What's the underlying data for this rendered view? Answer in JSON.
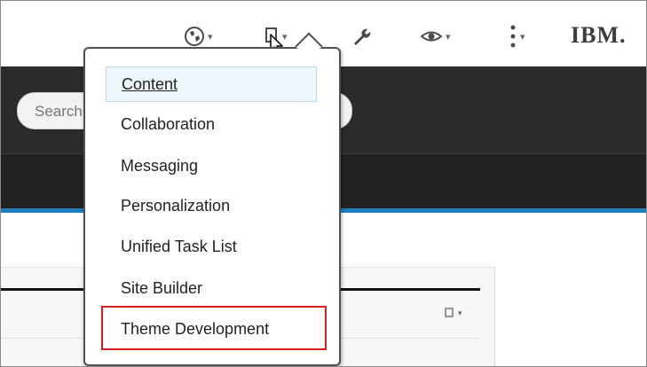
{
  "search": {
    "placeholder": "Search"
  },
  "brand": {
    "logo_text": "IBM."
  },
  "toolbar": {
    "icons": [
      "globe-icon",
      "page-icon",
      "wrench-icon",
      "eye-icon",
      "more-vertical-icon"
    ]
  },
  "menu": {
    "items": [
      {
        "label": "Content",
        "selected": true
      },
      {
        "label": "Collaboration"
      },
      {
        "label": "Messaging"
      },
      {
        "label": "Personalization"
      },
      {
        "label": "Unified Task List"
      },
      {
        "label": "Site Builder"
      },
      {
        "label": "Theme Development",
        "highlighted": true
      }
    ]
  },
  "colors": {
    "accent_blue": "#1e7fbf",
    "highlight_red": "#d51f1f",
    "dark_bar": "#2b2b2b"
  }
}
